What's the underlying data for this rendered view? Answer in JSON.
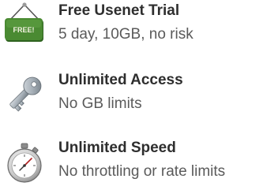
{
  "features": [
    {
      "icon": "free-sign-icon",
      "sign_text": "FREE!",
      "title": "Free Usenet Trial",
      "description": "5 day, 10GB, no risk"
    },
    {
      "icon": "key-icon",
      "title": "Unlimited Access",
      "description": "No GB limits"
    },
    {
      "icon": "stopwatch-icon",
      "title": "Unlimited Speed",
      "description": "No throttling or rate limits"
    }
  ],
  "colors": {
    "sign_green": "#3f7a2a",
    "title_text": "#2e2e2e",
    "description_text": "#5a5a5a"
  }
}
